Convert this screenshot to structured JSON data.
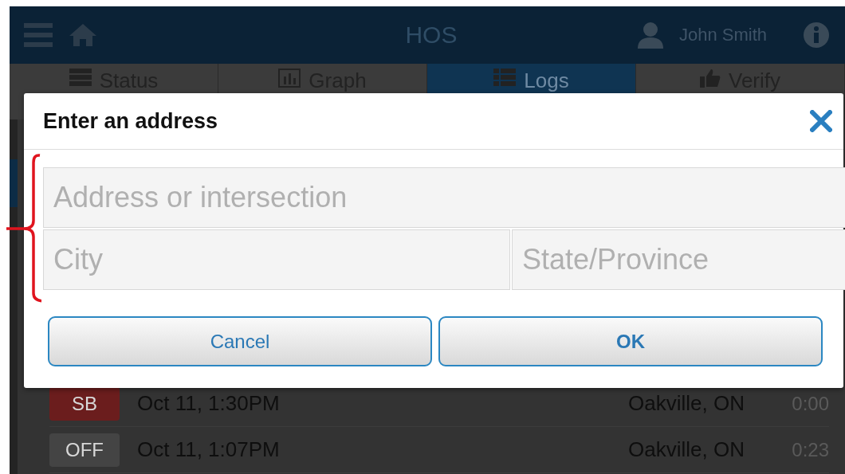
{
  "header": {
    "title": "HOS",
    "user": "John Smith"
  },
  "tabs": [
    {
      "label": "Status",
      "selected": false
    },
    {
      "label": "Graph",
      "selected": false
    },
    {
      "label": "Logs",
      "selected": true
    },
    {
      "label": "Verify",
      "selected": false
    }
  ],
  "log_rows": [
    {
      "status": "SB",
      "color": "#6b1d1d",
      "time": "Oct 11, 1:30PM",
      "location": "Oakville, ON",
      "duration": "0:00"
    },
    {
      "status": "OFF",
      "color": "#444444",
      "time": "Oct 11, 1:07PM",
      "location": "Oakville, ON",
      "duration": "0:23"
    }
  ],
  "dialog": {
    "title": "Enter an address",
    "fields": [
      {
        "placeholder": "Address or intersection"
      },
      {
        "placeholder": "City"
      },
      {
        "placeholder": "State/Province"
      }
    ],
    "buttons": [
      {
        "label": "Cancel",
        "kind": "secondary"
      },
      {
        "label": "OK",
        "kind": "primary"
      }
    ]
  },
  "annotation": {
    "kind": "bracket"
  }
}
